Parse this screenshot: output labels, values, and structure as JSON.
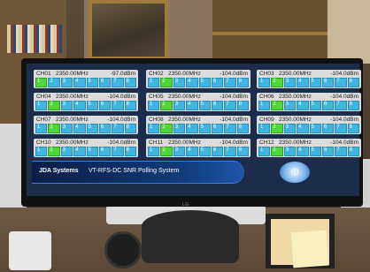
{
  "app": {
    "brand": "JDA Systems",
    "subtitle": "VT-RFS-DC SNR Polling System",
    "monitor_logo": "LG"
  },
  "channel_buttons": [
    "1",
    "2",
    "3",
    "4",
    "5",
    "6",
    "7",
    "8"
  ],
  "channels": [
    {
      "name": "CH01",
      "freq": "2350.00MHz",
      "snr": "-97.0dBm",
      "active": 0
    },
    {
      "name": "CH02",
      "freq": "2350.00MHz",
      "snr": "-104.0dBm",
      "active": 1
    },
    {
      "name": "CH03",
      "freq": "2350.00MHz",
      "snr": "-104.0dBm",
      "active": 1
    },
    {
      "name": "CH04",
      "freq": "2350.00MHz",
      "snr": "-104.0dBm",
      "active": 1
    },
    {
      "name": "CH05",
      "freq": "2350.00MHz",
      "snr": "-104.0dBm",
      "active": 1
    },
    {
      "name": "CH06",
      "freq": "2350.00MHz",
      "snr": "-104.0dBm",
      "active": 1
    },
    {
      "name": "CH07",
      "freq": "2350.00MHz",
      "snr": "-104.0dBm",
      "active": 1
    },
    {
      "name": "CH08",
      "freq": "2350.00MHz",
      "snr": "-104.0dBm",
      "active": 1
    },
    {
      "name": "CH09",
      "freq": "2350.00MHz",
      "snr": "-104.0dBm",
      "active": 1
    },
    {
      "name": "CH10",
      "freq": "2350.00MHz",
      "snr": "-104.0dBm",
      "active": 1
    },
    {
      "name": "CH11",
      "freq": "2350.00MHz",
      "snr": "-104.0dBm",
      "active": 1
    },
    {
      "name": "CH12",
      "freq": "2350.00MHz",
      "snr": "-104.0dBm",
      "active": 1
    }
  ],
  "power_icon": "power-icon",
  "colors": {
    "button_blue": "#3fb5e0",
    "button_active": "#4fd63a",
    "screen_bg": "#1d2c4a"
  }
}
